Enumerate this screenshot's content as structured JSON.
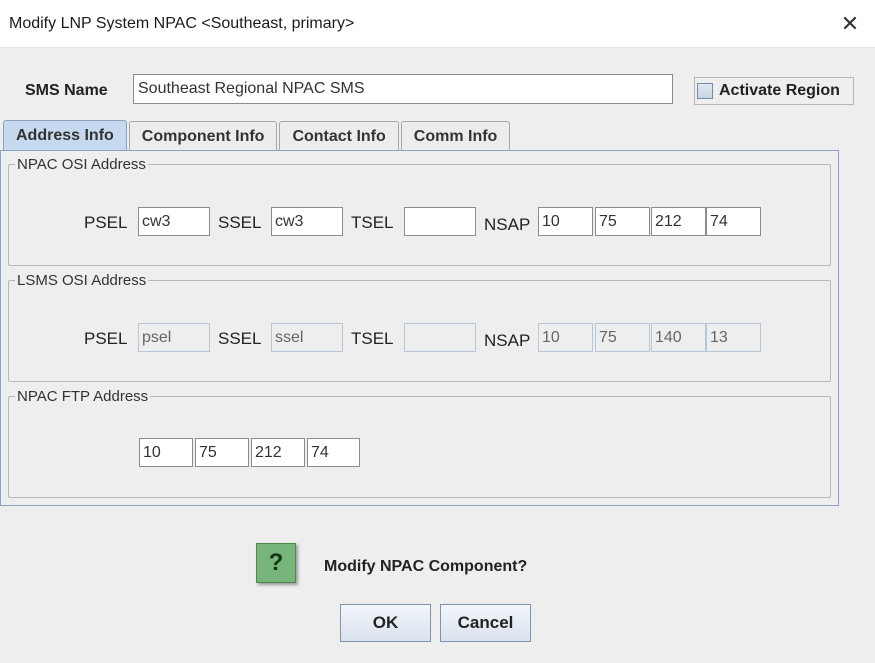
{
  "window": {
    "title": "Modify LNP System NPAC <Southeast,  primary>",
    "close_glyph": "✕"
  },
  "sms": {
    "label": "SMS Name",
    "value": "Southeast Regional NPAC SMS"
  },
  "activate": {
    "label": "Activate Region",
    "checked": false
  },
  "tabs": [
    {
      "label": "Address Info",
      "active": true
    },
    {
      "label": "Component Info",
      "active": false
    },
    {
      "label": "Contact Info",
      "active": false
    },
    {
      "label": "Comm Info",
      "active": false
    }
  ],
  "npac_osi": {
    "legend": "NPAC OSI Address",
    "psel_label": "PSEL",
    "psel": "cw3",
    "ssel_label": "SSEL",
    "ssel": "cw3",
    "tsel_label": "TSEL",
    "tsel": "",
    "nsap_label": "NSAP",
    "nsap": [
      "10",
      "75",
      "212",
      "74"
    ]
  },
  "lsms_osi": {
    "legend": "LSMS OSI Address",
    "psel_label": "PSEL",
    "psel": "psel",
    "ssel_label": "SSEL",
    "ssel": "ssel",
    "tsel_label": "TSEL",
    "tsel": "",
    "nsap_label": "NSAP",
    "nsap": [
      "10",
      "75",
      "140",
      "13"
    ]
  },
  "npac_ftp": {
    "legend": "NPAC FTP Address",
    "ip": [
      "10",
      "75",
      "212",
      "74"
    ]
  },
  "dialog": {
    "icon": "?",
    "message": "Modify NPAC Component?",
    "ok_label": "OK",
    "cancel_label": "Cancel"
  },
  "colors": {
    "active_tab": "#c7d9ef",
    "question_icon": "#78b57a",
    "panel_border": "#8aa3c2"
  }
}
